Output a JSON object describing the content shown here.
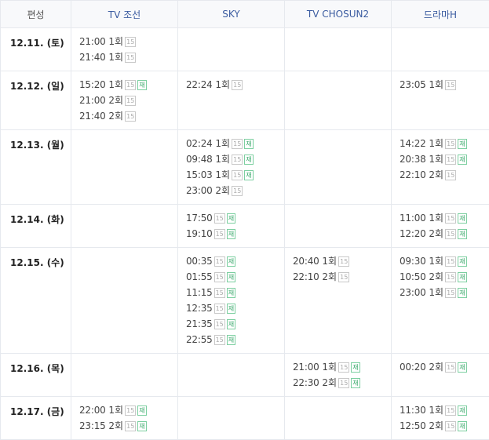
{
  "headers": [
    "편성",
    "TV 조선",
    "SKY",
    "TV CHOSUN2",
    "드라마H"
  ],
  "badges": {
    "age": "15",
    "rerun": "재"
  },
  "rows": [
    {
      "date": "12.11. (토)",
      "cells": [
        [
          {
            "time": "21:00",
            "ep": "1회",
            "re": false
          },
          {
            "time": "21:40",
            "ep": "1회",
            "re": false
          }
        ],
        [],
        [],
        []
      ]
    },
    {
      "date": "12.12. (일)",
      "cells": [
        [
          {
            "time": "15:20",
            "ep": "1회",
            "re": true
          },
          {
            "time": "21:00",
            "ep": "2회",
            "re": false
          },
          {
            "time": "21:40",
            "ep": "2회",
            "re": false
          }
        ],
        [
          {
            "time": "22:24",
            "ep": "1회",
            "re": false
          }
        ],
        [],
        [
          {
            "time": "23:05",
            "ep": "1회",
            "re": false
          }
        ]
      ]
    },
    {
      "date": "12.13. (월)",
      "cells": [
        [],
        [
          {
            "time": "02:24",
            "ep": "1회",
            "re": true
          },
          {
            "time": "09:48",
            "ep": "1회",
            "re": true
          },
          {
            "time": "15:03",
            "ep": "1회",
            "re": true
          },
          {
            "time": "23:00",
            "ep": "2회",
            "re": false
          }
        ],
        [],
        [
          {
            "time": "14:22",
            "ep": "1회",
            "re": true
          },
          {
            "time": "20:38",
            "ep": "1회",
            "re": true
          },
          {
            "time": "22:10",
            "ep": "2회",
            "re": false
          }
        ]
      ]
    },
    {
      "date": "12.14. (화)",
      "cells": [
        [],
        [
          {
            "time": "17:50",
            "ep": "",
            "re": true
          },
          {
            "time": "19:10",
            "ep": "",
            "re": true
          }
        ],
        [],
        [
          {
            "time": "11:00",
            "ep": "1회",
            "re": true
          },
          {
            "time": "12:20",
            "ep": "2회",
            "re": true
          }
        ]
      ]
    },
    {
      "date": "12.15. (수)",
      "cells": [
        [],
        [
          {
            "time": "00:35",
            "ep": "",
            "re": true
          },
          {
            "time": "01:55",
            "ep": "",
            "re": true
          },
          {
            "time": "11:15",
            "ep": "",
            "re": true
          },
          {
            "time": "12:35",
            "ep": "",
            "re": true
          },
          {
            "time": "21:35",
            "ep": "",
            "re": true
          },
          {
            "time": "22:55",
            "ep": "",
            "re": true
          }
        ],
        [
          {
            "time": "20:40",
            "ep": "1회",
            "re": false
          },
          {
            "time": "22:10",
            "ep": "2회",
            "re": false
          }
        ],
        [
          {
            "time": "09:30",
            "ep": "1회",
            "re": true
          },
          {
            "time": "10:50",
            "ep": "2회",
            "re": true
          },
          {
            "time": "23:00",
            "ep": "1회",
            "re": true
          }
        ]
      ]
    },
    {
      "date": "12.16. (목)",
      "cells": [
        [],
        [],
        [
          {
            "time": "21:00",
            "ep": "1회",
            "re": true
          },
          {
            "time": "22:30",
            "ep": "2회",
            "re": true
          }
        ],
        [
          {
            "time": "00:20",
            "ep": "2회",
            "re": true
          }
        ]
      ]
    },
    {
      "date": "12.17. (금)",
      "cells": [
        [
          {
            "time": "22:00",
            "ep": "1회",
            "re": true
          },
          {
            "time": "23:15",
            "ep": "2회",
            "re": true
          }
        ],
        [],
        [],
        [
          {
            "time": "11:30",
            "ep": "1회",
            "re": true
          },
          {
            "time": "12:50",
            "ep": "2회",
            "re": true
          }
        ]
      ]
    }
  ]
}
